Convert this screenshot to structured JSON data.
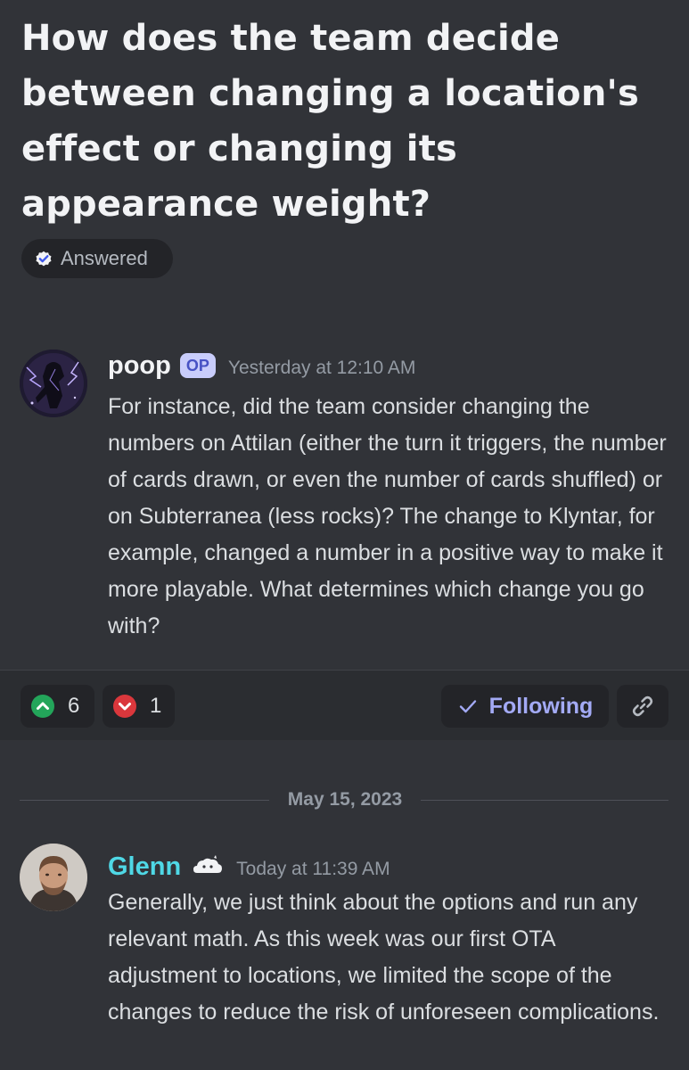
{
  "thread": {
    "title": "How does the team decide between changing a location's effect or changing its appearance weight?",
    "status": "Answered"
  },
  "op_post": {
    "author": "poop",
    "badge": "OP",
    "timestamp": "Yesterday at 12:10 AM",
    "body": "For instance, did the team consider changing the numbers on Attilan (either the turn it triggers, the number of cards drawn, or even the number of cards shuffled) or on Subterranea (less rocks)? The change to Klyntar, for example, changed a number in a positive way to make it more playable. What determines which change you go with?"
  },
  "reactions": {
    "upvote_count": "6",
    "downvote_count": "1",
    "upvote_color": "#23a55a",
    "downvote_color": "#da373c"
  },
  "actions": {
    "follow_label": "Following"
  },
  "date_separator": "May 15, 2023",
  "reply": {
    "author": "Glenn",
    "timestamp": "Today at 11:39 AM",
    "body": "Generally, we just think about the options and run any relevant math. As this week was our first OTA adjustment to locations, we limited the scope of the changes to reduce the risk of unforeseen complications.",
    "name_color": "#4fd8e6"
  },
  "icons": {
    "status": "answered-check-icon",
    "upvote": "chevron-up-icon",
    "downvote": "chevron-down-icon",
    "follow": "checkmark-icon",
    "link": "link-icon",
    "author_tag": "cloud-tag-icon"
  }
}
